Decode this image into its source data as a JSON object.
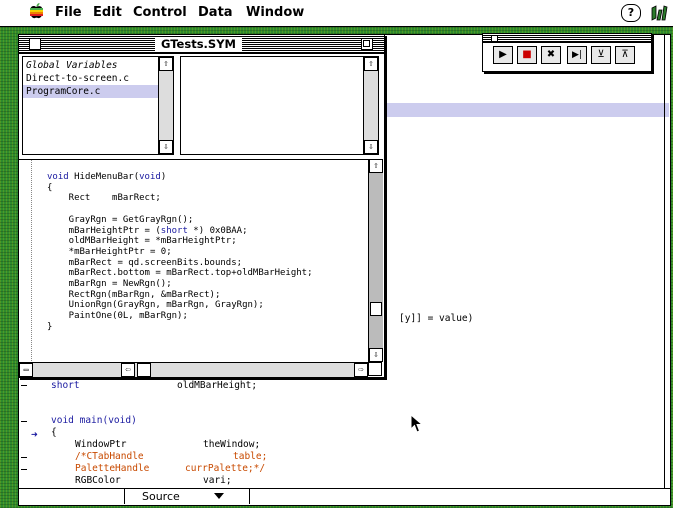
{
  "menubar": {
    "items": [
      "File",
      "Edit",
      "Control",
      "Data",
      "Window"
    ],
    "help_label": "?"
  },
  "sym_window": {
    "title": "GTests.SYM",
    "files": [
      "Global Variables",
      "Direct-to-screen.c",
      "ProgramCore.c"
    ],
    "code_lines": [
      "void HideMenuBar(void)",
      "{",
      "    Rect    mBarRect;",
      "",
      "    GrayRgn = GetGrayRgn();",
      "    mBarHeightPtr = (short *) 0x0BAA;",
      "    oldMBarHeight = *mBarHeightPtr;",
      "    *mBarHeightPtr = 0;",
      "    mBarRect = qd.screenBits.bounds;",
      "    mBarRect.bottom = mBarRect.top+oldMBarHeight;",
      "    mBarRgn = NewRgn();",
      "    RectRgn(mBarRgn, &mBarRect);",
      "    UnionRgn(GrayRgn, mBarRgn, GrayRgn);",
      "    PaintOne(0L, mBarRgn);",
      "}"
    ]
  },
  "editor": {
    "fragment": "[y]] = value)",
    "decl_type": "short",
    "decl_name": "oldMBarHeight;",
    "main_sig": "void main(void)",
    "open_brace": "{",
    "vars": [
      {
        "type": "WindowPtr",
        "name": "theWindow;",
        "color": "#000000"
      },
      {
        "type": "/*CTabHandle",
        "name": "table;",
        "color": "#c84a00"
      },
      {
        "type": "PaletteHandle",
        "name": "currPalette;*/",
        "color": "#c84a00"
      },
      {
        "type": "RGBColor",
        "name": "vari;",
        "color": "#000000"
      }
    ],
    "source_menu": "Source"
  },
  "palette": {
    "buttons": [
      {
        "icon": "go-icon",
        "glyph": "▶"
      },
      {
        "icon": "stop-icon",
        "glyph": "■"
      },
      {
        "icon": "kill-icon",
        "glyph": "✖"
      },
      {
        "icon": "step-into-icon",
        "glyph": "▶|"
      },
      {
        "icon": "step-over-icon",
        "glyph": "⊻"
      },
      {
        "icon": "step-out-icon",
        "glyph": "⊼"
      }
    ]
  },
  "colors": {
    "desktop": "#2e8a2e",
    "selection": "#ccccee",
    "comment": "#c84a00",
    "keyword": "#1a1aa0",
    "stop_red": "#cc0000"
  }
}
